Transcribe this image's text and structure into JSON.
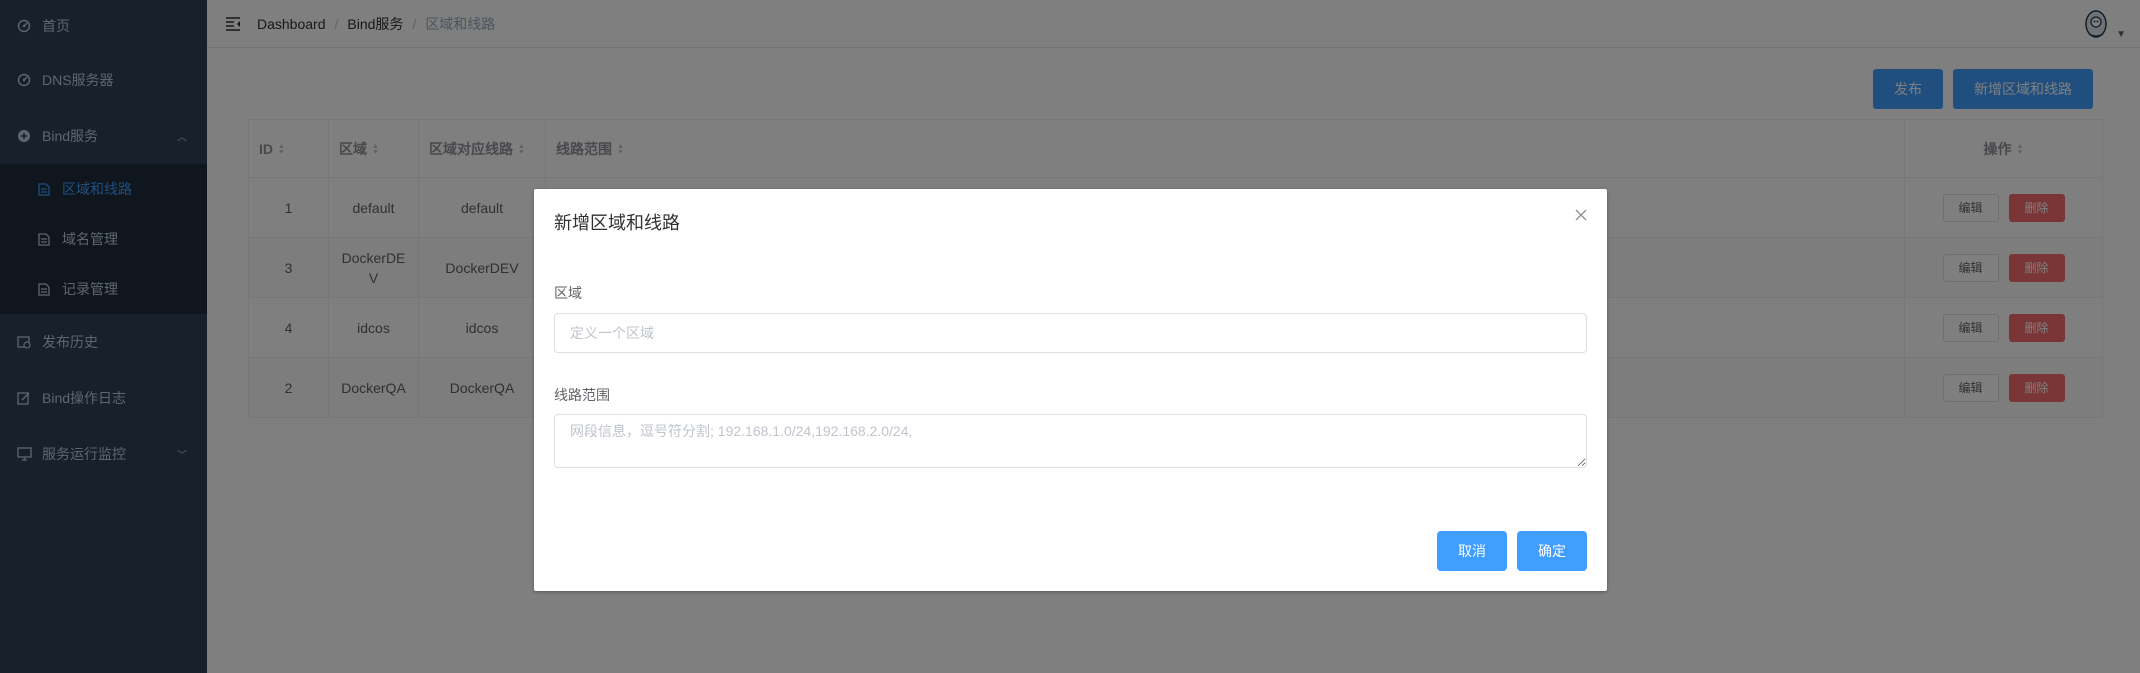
{
  "sidebar": {
    "items": [
      {
        "label": "首页",
        "icon": "dashboard-icon"
      },
      {
        "label": "DNS服务器",
        "icon": "dashboard-icon"
      },
      {
        "label": "Bind服务",
        "icon": "plus-circle-icon",
        "expanded": true
      },
      {
        "label": "发布历史",
        "icon": "history-icon"
      },
      {
        "label": "Bind操作日志",
        "icon": "edit-log-icon"
      },
      {
        "label": "服务运行监控",
        "icon": "monitor-icon"
      }
    ],
    "subitems": [
      {
        "label": "区域和线路",
        "icon": "document-icon",
        "active": true
      },
      {
        "label": "域名管理",
        "icon": "document-icon"
      },
      {
        "label": "记录管理",
        "icon": "document-icon"
      }
    ]
  },
  "header": {
    "breadcrumb": [
      "Dashboard",
      "Bind服务",
      "区域和线路"
    ]
  },
  "toolbar": {
    "publish_label": "发布",
    "add_label": "新增区域和线路"
  },
  "table": {
    "columns": [
      "ID",
      "区域",
      "区域对应线路",
      "线路范围",
      "操作"
    ],
    "rows": [
      {
        "id": "1",
        "zone": "default",
        "line": "default",
        "range": ""
      },
      {
        "id": "3",
        "zone": "DockerDE\nV",
        "line": "DockerDEV",
        "range": ""
      },
      {
        "id": "4",
        "zone": "idcos",
        "line": "idcos",
        "range": ""
      },
      {
        "id": "2",
        "zone": "DockerQA",
        "line": "DockerQA",
        "range": ""
      }
    ],
    "edit_label": "编辑",
    "delete_label": "删除"
  },
  "dialog": {
    "title": "新增区域和线路",
    "zone_label": "区域",
    "zone_placeholder": "定义一个区域",
    "zone_value": "",
    "range_label": "线路范围",
    "range_placeholder": "网段信息，逗号符分割; 192.168.1.0/24,192.168.2.0/24,",
    "range_value": "",
    "cancel_label": "取消",
    "confirm_label": "确定"
  },
  "colors": {
    "sidebar_bg": "#304156",
    "submenu_bg": "#1f2d3d",
    "accent": "#409eff",
    "danger": "#f56c6c"
  }
}
